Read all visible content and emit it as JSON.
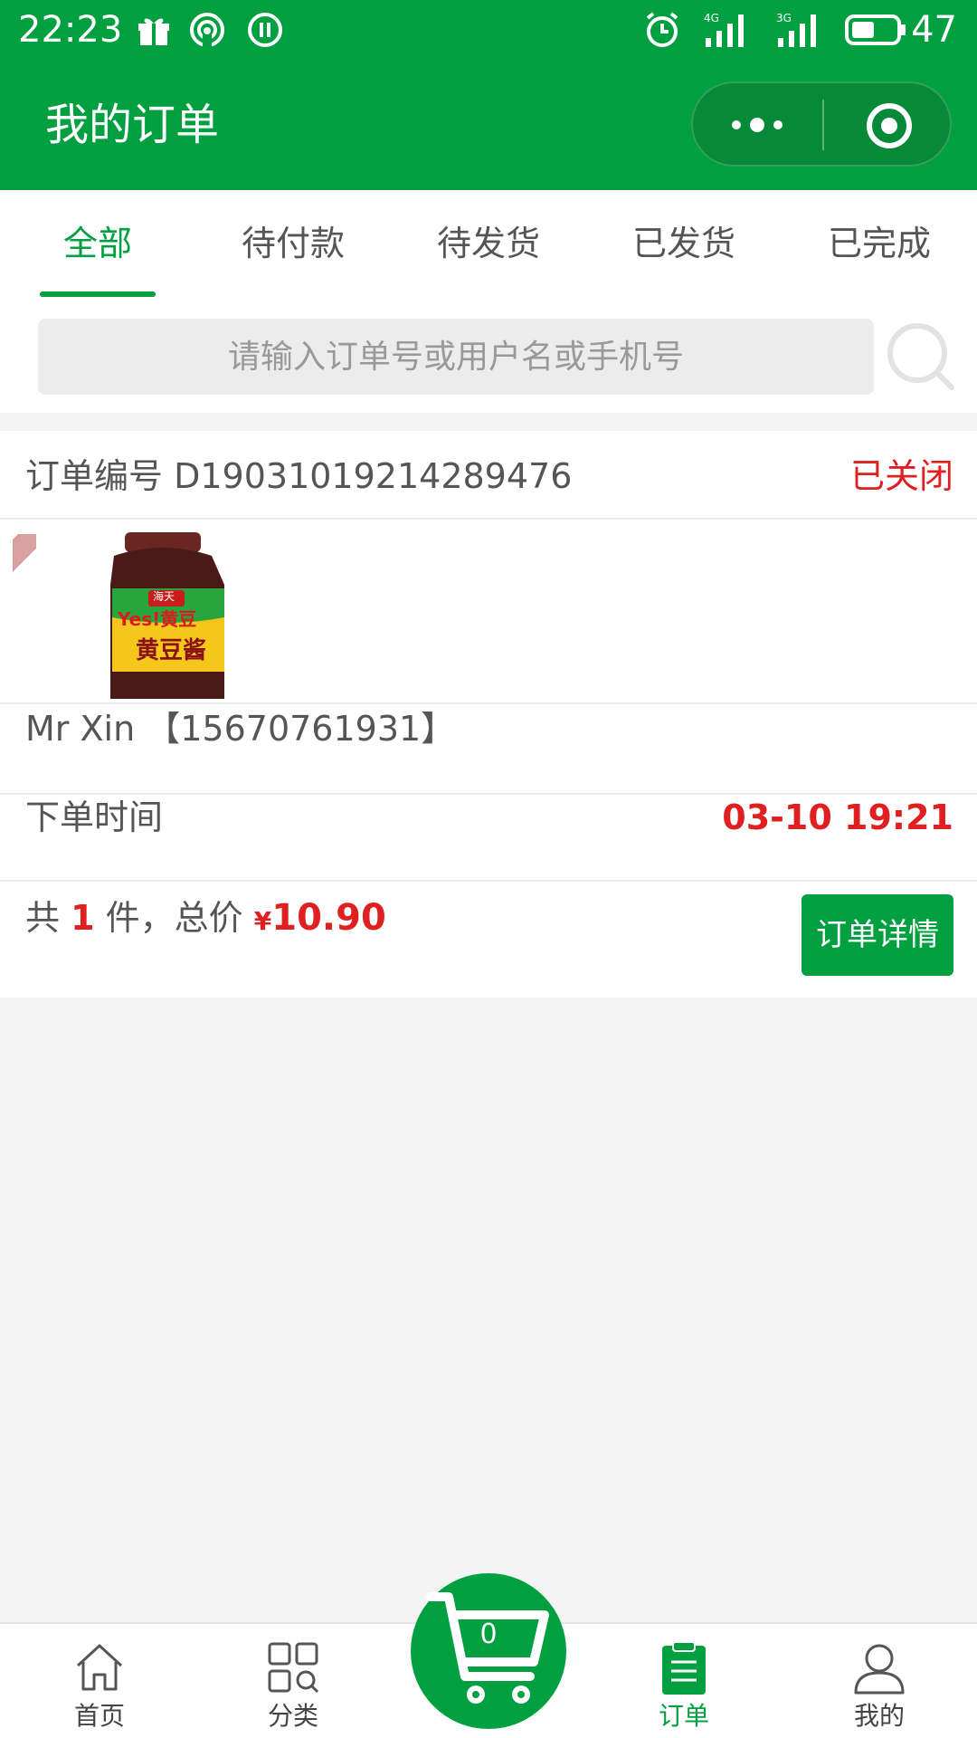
{
  "status_bar": {
    "time": "22:23",
    "battery": "47",
    "network_labels": [
      "4G",
      "3G"
    ]
  },
  "header": {
    "title": "我的订单"
  },
  "tabs": [
    {
      "label": "全部",
      "active": true
    },
    {
      "label": "待付款",
      "active": false
    },
    {
      "label": "待发货",
      "active": false
    },
    {
      "label": "已发货",
      "active": false
    },
    {
      "label": "已完成",
      "active": false
    }
  ],
  "search": {
    "placeholder": "请输入订单号或用户名或手机号"
  },
  "order": {
    "number_label": "订单编号",
    "number": "D19031019214289476",
    "status": "已关闭",
    "product_text": {
      "brand": "海天",
      "slogan": "Yes!黄豆",
      "name": "黄豆酱"
    },
    "customer": "Mr Xin  【15670761931】",
    "time_label": "下单时间",
    "time": "03-10 19:21",
    "summary_prefix": "共",
    "count": "1",
    "summary_mid": "件，总价",
    "currency": "¥",
    "price": "10.90",
    "detail_button": "订单详情"
  },
  "bottom_nav": {
    "items": [
      {
        "label": "首页",
        "icon": "home-icon"
      },
      {
        "label": "分类",
        "icon": "category-icon"
      },
      {
        "label": "订单",
        "icon": "clipboard-icon",
        "active": true
      },
      {
        "label": "我的",
        "icon": "user-icon"
      }
    ],
    "cart_count": "0"
  },
  "colors": {
    "brand_green": "#00a040",
    "accent_red": "#e02020",
    "background": "#f4f4f4"
  }
}
